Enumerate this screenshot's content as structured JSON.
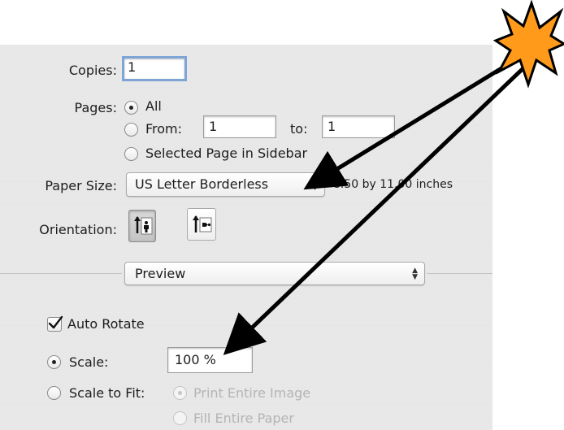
{
  "copies": {
    "label": "Copies:",
    "value": "1"
  },
  "pages": {
    "label": "Pages:",
    "all_label": "All",
    "from_label": "From:",
    "from_value": "1",
    "to_label": "to:",
    "to_value": "1",
    "selected_label": "Selected Page in Sidebar",
    "selected_option": "All"
  },
  "paper_size": {
    "label": "Paper Size:",
    "value": "US Letter Borderless",
    "dimensions": "8.50 by 11.00 inches"
  },
  "orientation": {
    "label": "Orientation:",
    "options": [
      "portrait-icon",
      "landscape-icon"
    ],
    "selected": "portrait"
  },
  "section_popup": {
    "value": "Preview"
  },
  "auto_rotate": {
    "label": "Auto Rotate",
    "checked": true
  },
  "scale": {
    "label": "Scale:",
    "value": "100 %",
    "selected": true
  },
  "scale_to_fit": {
    "label": "Scale to Fit:",
    "print_entire_label": "Print Entire Image",
    "fill_entire_label": "Fill Entire Paper"
  },
  "annotation": {
    "star_color": "#ff9a1a",
    "arrow_color": "#000000"
  }
}
